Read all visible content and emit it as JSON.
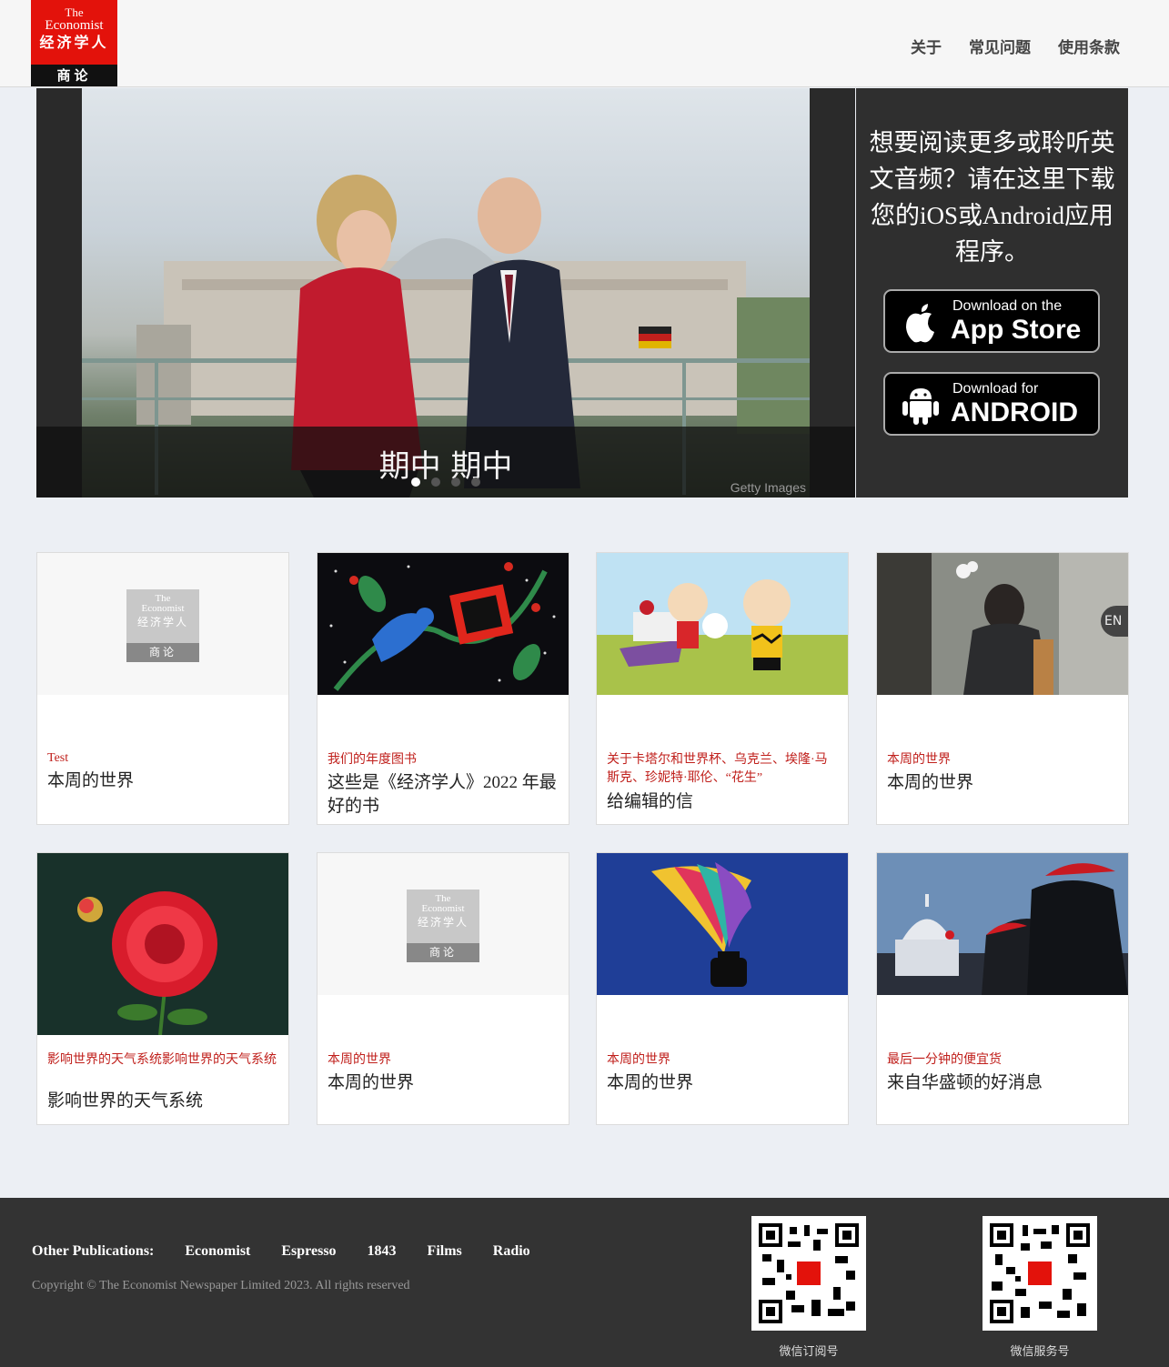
{
  "header": {
    "logo": {
      "the": "The",
      "economist": "Economist",
      "cn": "经济学人",
      "sub": "商论"
    },
    "nav": [
      "关于",
      "常见问题",
      "使用条款"
    ]
  },
  "hero": {
    "title": "期中 期中",
    "credit": "Getty Images",
    "slides": 4,
    "active_slide": 1
  },
  "app_panel": {
    "promo": "想要阅读更多或聆听英文音频？请在这里下载您的iOS或Android应用程序。",
    "ios": {
      "small": "Download on the",
      "big": "App Store"
    },
    "android": {
      "small": "Download for",
      "big": "ANDROID"
    }
  },
  "cards": [
    {
      "kicker": "Test",
      "headline": "本周的世界"
    },
    {
      "kicker": "我们的年度图书",
      "headline": "这些是《经济学人》2022 年最好的书"
    },
    {
      "kicker": "关于卡塔尔和世界杯、乌克兰、埃隆·马斯克、珍妮特·耶伦、“花生”",
      "headline": "给编辑的信"
    },
    {
      "kicker": "本周的世界",
      "headline": "本周的世界",
      "badge": "EN"
    },
    {
      "kicker": "影响世界的天气系统影响世界的天气系统",
      "headline": "影响世界的天气系统"
    },
    {
      "kicker": "本周的世界",
      "headline": "本周的世界"
    },
    {
      "kicker": "本周的世界",
      "headline": "本周的世界"
    },
    {
      "kicker": "最后一分钟的便宜货",
      "headline": "来自华盛顿的好消息"
    }
  ],
  "footer": {
    "pubs_label": "Other Publications:",
    "pubs": [
      "Economist",
      "Espresso",
      "1843",
      "Films",
      "Radio"
    ],
    "copyright": "Copyright © The Economist Newspaper Limited 2023. All rights reserved",
    "qr": [
      "微信订阅号",
      "微信服务号"
    ]
  }
}
